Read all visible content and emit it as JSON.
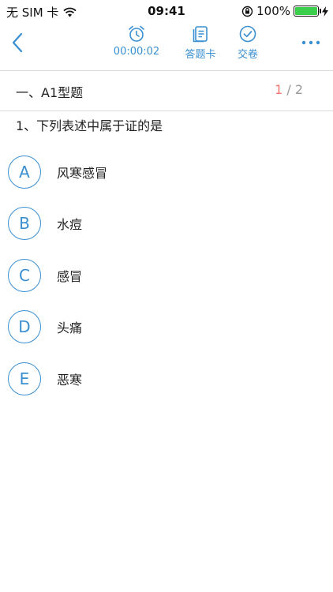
{
  "status_bar": {
    "carrier": "无 SIM 卡",
    "time": "09:41",
    "battery": "100%",
    "battery_level": 1.0
  },
  "nav": {
    "timer": "00:00:02",
    "answer_card": "答题卡",
    "submit": "交卷"
  },
  "section": {
    "title": "一、A1型题",
    "current": "1",
    "total": "/ 2"
  },
  "question": "1、下列表述中属于证的是",
  "options": [
    {
      "letter": "A",
      "text": "风寒感冒"
    },
    {
      "letter": "B",
      "text": "水痘"
    },
    {
      "letter": "C",
      "text": "感冒"
    },
    {
      "letter": "D",
      "text": "头痛"
    },
    {
      "letter": "E",
      "text": "恶寒"
    }
  ],
  "colors": {
    "accent": "#3a8fd0",
    "page_current": "#f07a6e",
    "battery_fill": "#3ccf4e"
  }
}
